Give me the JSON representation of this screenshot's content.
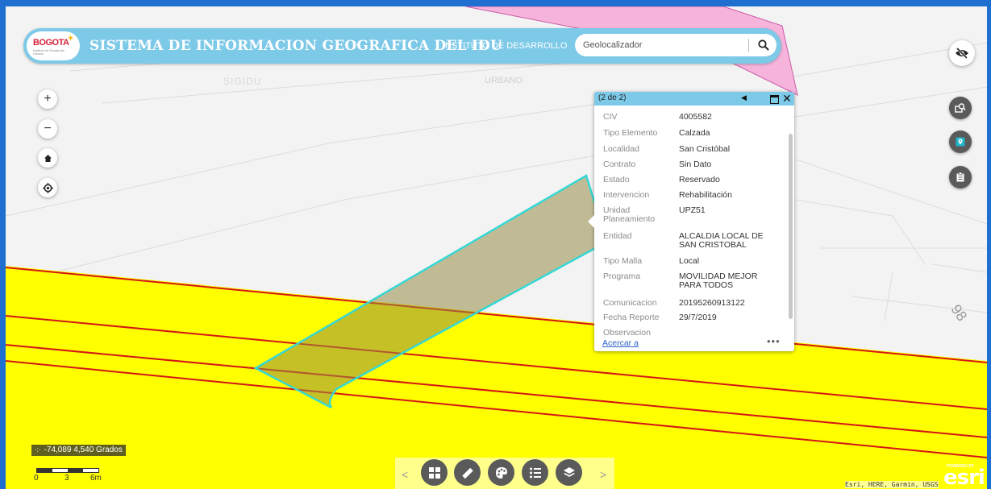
{
  "header": {
    "logo_text": "BOGOTA",
    "logo_subtext": "Instituto de Desarrollo Urbano",
    "title": "SISTEMA DE INFORMACION GEOGRAFICA DEL IDU",
    "subtitle": "INSTITUTO DE DESARROLLO",
    "search": {
      "placeholder": "Geolocalizador",
      "value": ""
    }
  },
  "map": {
    "labels": [
      "SIGIDU",
      "URBANO"
    ],
    "street_number": "98",
    "colors": {
      "zone": "#ffff00",
      "line": "#d41616",
      "selection": "#35d7d4",
      "selection_fill": "#b9b26b",
      "pink_area": "#f6b4dc"
    }
  },
  "left_controls": [
    {
      "name": "zoom-in",
      "glyph": "+"
    },
    {
      "name": "zoom-out",
      "glyph": "−"
    },
    {
      "name": "home",
      "glyph": "⌂"
    },
    {
      "name": "locate",
      "glyph": "◎"
    }
  ],
  "right_controls": [
    "hide-panel-icon",
    "identify-icon",
    "geolocate-icon",
    "print-icon"
  ],
  "popup": {
    "count": "(2 de 2)",
    "fields": [
      {
        "label": "CIV",
        "value": "4005582"
      },
      {
        "label": "Tipo Elemento",
        "value": "Calzada"
      },
      {
        "label": "Localidad",
        "value": "San Cristóbal"
      },
      {
        "label": "Contrato",
        "value": "Sin Dato"
      },
      {
        "label": "Estado",
        "value": "Reservado"
      },
      {
        "label": "Intervencion",
        "value": "Rehabilitación"
      },
      {
        "label": "Unidad Planeamiento",
        "value": "UPZ51"
      },
      {
        "label": "Entidad",
        "value": "ALCALDIA LOCAL DE SAN CRISTOBAL"
      },
      {
        "label": "Tipo Malla",
        "value": "Local"
      },
      {
        "label": "Programa",
        "value": "MOVILIDAD MEJOR PARA TODOS"
      },
      {
        "label": "Comunicacion",
        "value": "20195260913122"
      },
      {
        "label": "Fecha Reporte",
        "value": "29/7/2019"
      },
      {
        "label": "Observacion",
        "value": ""
      }
    ],
    "zoom_link": "Acercar a",
    "more": "•••"
  },
  "coordinates": "-74,089 4,540 Grados",
  "scale": {
    "labels": [
      "0",
      "3",
      "6m"
    ]
  },
  "toolbar": {
    "prev": "<",
    "next": ">",
    "buttons": [
      "grid-icon",
      "ruler-icon",
      "palette-icon",
      "legend-list-icon",
      "layers-icon"
    ]
  },
  "attribution": "Esri, HERE, Garmin, USGS",
  "esri": {
    "powered_by": "POWERED BY",
    "logo": "esri"
  }
}
